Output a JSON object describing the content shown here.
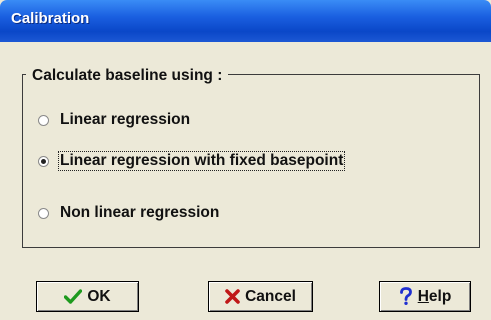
{
  "window": {
    "title": "Calibration"
  },
  "group": {
    "legend": "Calculate baseline using :",
    "options": [
      {
        "label": "Linear regression",
        "selected": false
      },
      {
        "label": "Linear regression with fixed basepoint",
        "selected": true
      },
      {
        "label": "Non linear regression",
        "selected": false
      }
    ]
  },
  "buttons": {
    "ok": "OK",
    "cancel": "Cancel",
    "help_mnemonic": "H",
    "help_rest": "elp"
  },
  "icons": {
    "ok": "checkmark-icon",
    "cancel": "x-icon",
    "help": "question-mark-icon"
  },
  "colors": {
    "titlebar": "#0a47c8",
    "background": "#ece9d8",
    "ok_icon": "#1e9a1e",
    "cancel_icon": "#c01818",
    "help_icon": "#1f2fd0"
  }
}
